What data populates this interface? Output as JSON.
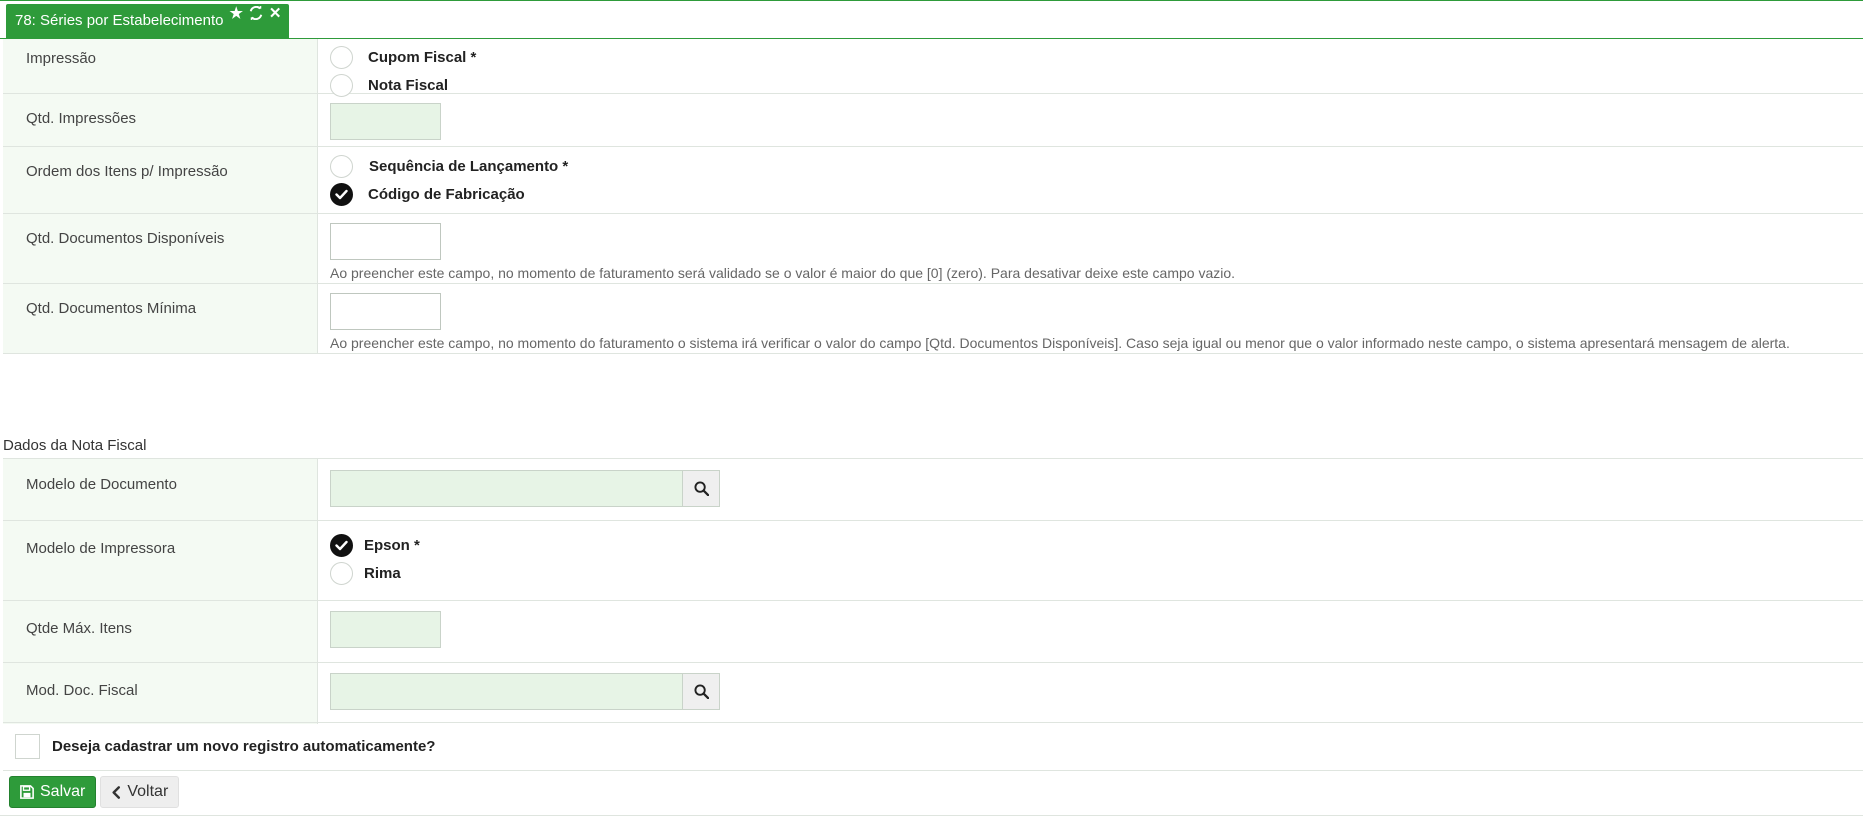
{
  "tab": {
    "title": "78: Séries por Estabelecimento",
    "icons": [
      "star-icon",
      "refresh-icon",
      "close-icon"
    ],
    "color": "#2e9b3a"
  },
  "impressao": {
    "label": "Impressão",
    "options": [
      {
        "label": "Cupom Fiscal *",
        "checked": false
      },
      {
        "label": "Nota Fiscal",
        "checked": false
      }
    ]
  },
  "qtd_impressoes": {
    "label": "Qtd. Impressões",
    "value": ""
  },
  "ordem_itens": {
    "label": "Ordem dos Itens p/ Impressão",
    "options": [
      {
        "label": "Sequência de Lançamento *",
        "checked": false
      },
      {
        "label": "Código de Fabricação",
        "checked": true
      }
    ]
  },
  "qtd_docs_disponiveis": {
    "label": "Qtd. Documentos Disponíveis",
    "value": "",
    "help": "Ao preencher este campo, no momento de faturamento será validado se o valor é maior do que [0] (zero). Para desativar deixe este campo vazio."
  },
  "qtd_docs_minima": {
    "label": "Qtd. Documentos Mínima",
    "value": "",
    "help": "Ao preencher este campo, no momento do faturamento o sistema irá verificar o valor do campo [Qtd. Documentos Disponíveis]. Caso seja igual ou menor que o valor informado neste campo, o sistema apresentará mensagem de alerta."
  },
  "section_nota_fiscal": "Dados da Nota Fiscal",
  "modelo_documento": {
    "label": "Modelo de Documento",
    "value": ""
  },
  "modelo_impressora": {
    "label": "Modelo de Impressora",
    "options": [
      {
        "label": "Epson *",
        "checked": true
      },
      {
        "label": "Rima",
        "checked": false
      }
    ]
  },
  "qtde_max_itens": {
    "label": "Qtde Máx. Itens",
    "value": ""
  },
  "mod_doc_fiscal": {
    "label": "Mod. Doc. Fiscal",
    "value": ""
  },
  "auto_register": {
    "label": "Deseja cadastrar um novo registro automaticamente?",
    "checked": false
  },
  "buttons": {
    "save": "Salvar",
    "back": "Voltar"
  }
}
